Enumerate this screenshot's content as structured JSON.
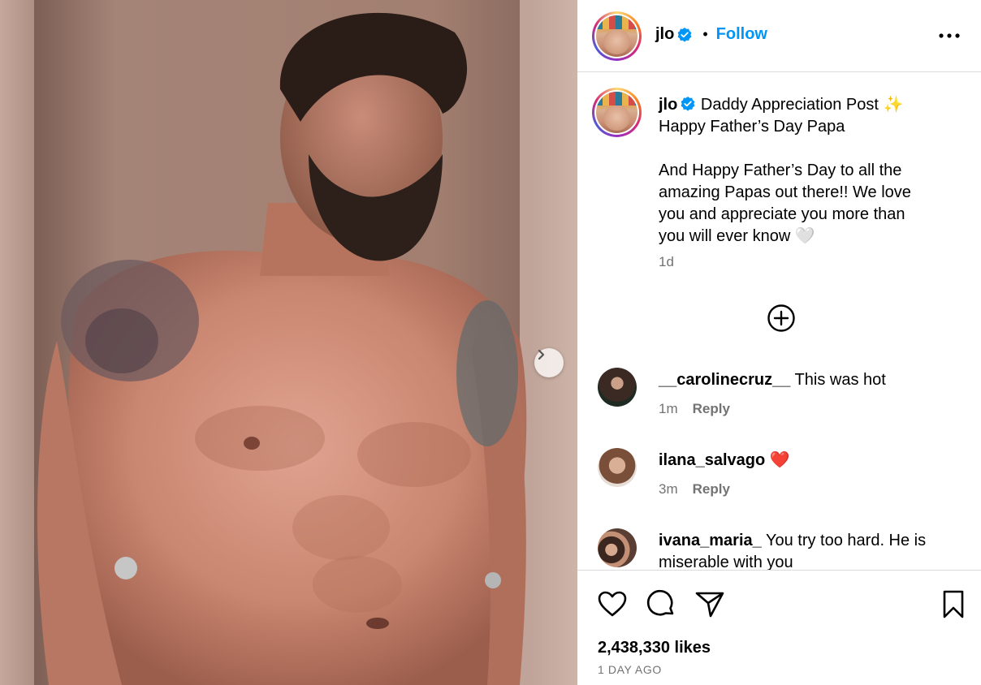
{
  "post_header": {
    "username": "jlo",
    "separator": "•",
    "follow_label": "Follow"
  },
  "caption": {
    "username": "jlo",
    "lines": [
      "Daddy Appreciation Post ✨",
      "Happy Father’s Day Papa",
      "",
      "And Happy Father’s Day to all the",
      "amazing Papas out there!! We love",
      "you and appreciate you more than",
      "you will ever know 🤍"
    ],
    "time": "1d"
  },
  "comments": [
    {
      "username": "__carolinecruz__",
      "text": "This was hot",
      "time": "1m",
      "reply_label": "Reply"
    },
    {
      "username": "ilana_salvago",
      "text": "❤️",
      "time": "3m",
      "reply_label": "Reply"
    },
    {
      "username": "ivana_maria_",
      "text": "You try too hard. He is miserable with you",
      "time": "",
      "reply_label": ""
    }
  ],
  "actions": {
    "like_icon": "heart-icon",
    "comment_icon": "speech-bubble-icon",
    "share_icon": "paper-plane-icon",
    "save_icon": "bookmark-icon"
  },
  "likes": "2,438,330 likes",
  "post_date": "1 DAY AGO",
  "colors": {
    "accent": "#0095f6",
    "muted": "#737373",
    "border": "#dbdbdb",
    "verified": "#0095f6"
  }
}
